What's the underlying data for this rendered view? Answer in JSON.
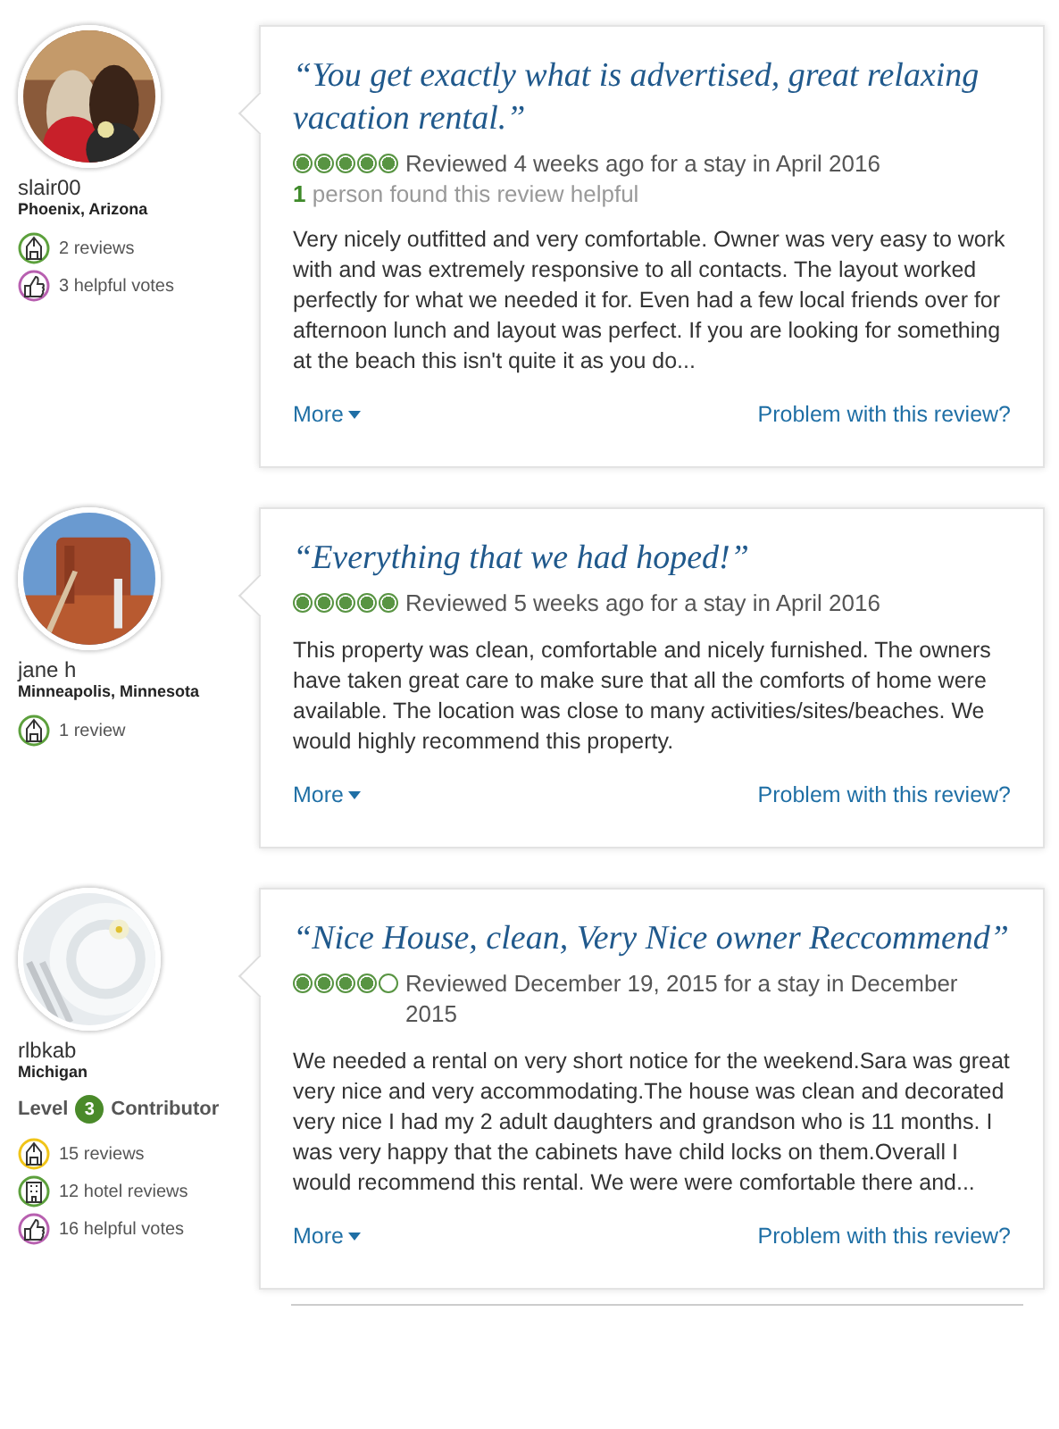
{
  "reviews": [
    {
      "reviewer": {
        "username": "slair00",
        "location": "Phoenix, Arizona",
        "stats": [
          {
            "kind": "reviews",
            "color": "#5ca03c",
            "label": "2 reviews"
          },
          {
            "kind": "votes",
            "color": "#b860b0",
            "label": "3 helpful votes"
          }
        ]
      },
      "title": "“You get exactly what is advertised, great relaxing vacation rental.”",
      "stars": 5,
      "reviewed": "Reviewed 4 weeks ago for a stay in April 2016",
      "helpful": {
        "count": "1",
        "text": "person found this review helpful"
      },
      "body": "Very nicely outfitted and very comfortable. Owner was very easy to work with and was extremely responsive to all contacts. The layout worked perfectly for what we needed it for. Even had a few local friends over for afternoon lunch and layout was perfect. If you are looking for something at the beach this isn't quite it as you do...",
      "more": "More",
      "problem": "Problem with this review?"
    },
    {
      "reviewer": {
        "username": "jane h",
        "location": "Minneapolis, Minnesota",
        "stats": [
          {
            "kind": "reviews",
            "color": "#5ca03c",
            "label": "1 review"
          }
        ]
      },
      "title": "“Everything that we had hoped!”",
      "stars": 5,
      "reviewed": "Reviewed 5 weeks ago for a stay in April 2016",
      "body": "This property was clean, comfortable and nicely furnished. The owners have taken great care to make sure that all the comforts of home were available. The location was close to many activities/sites/beaches. We would highly recommend this property.",
      "more": "More",
      "problem": "Problem with this review?"
    },
    {
      "reviewer": {
        "username": "rlbkab",
        "location": "Michigan",
        "level": {
          "prefix": "Level",
          "number": "3",
          "suffix": "Contributor"
        },
        "stats": [
          {
            "kind": "reviews",
            "color": "#f0c419",
            "label": "15 reviews"
          },
          {
            "kind": "hotel",
            "color": "#5ca03c",
            "label": "12 hotel reviews"
          },
          {
            "kind": "votes",
            "color": "#b860b0",
            "label": "16 helpful votes"
          }
        ]
      },
      "title": "“Nice House, clean, Very Nice owner Reccommend”",
      "stars": 4,
      "reviewed": "Reviewed December 19, 2015 for a stay in December 2015",
      "body": "We needed a rental on very short notice for the weekend.Sara was great very nice and very accommodating.The house was clean and decorated very nice I had my 2 adult daughters and grandson who is 11 months. I was very happy that the cabinets have child locks on them.Overall I would recommend this rental. We were were comfortable there and...",
      "more": "More",
      "problem": "Problem with this review?"
    }
  ]
}
